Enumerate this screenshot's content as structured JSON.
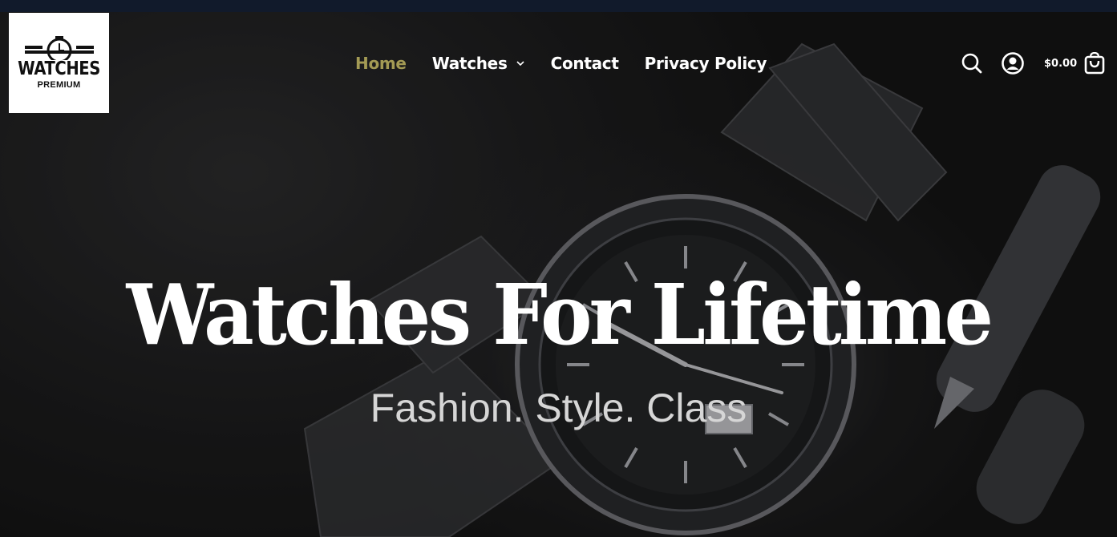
{
  "brand": {
    "logo_word": "WATCHES",
    "logo_sub": "PREMIUM"
  },
  "nav": {
    "items": [
      {
        "label": "Home",
        "active": true
      },
      {
        "label": "Watches",
        "has_dropdown": true
      },
      {
        "label": "Contact"
      },
      {
        "label": "Privacy Policy"
      }
    ]
  },
  "header_tools": {
    "search_icon": "search-icon",
    "account_icon": "user-circle-icon",
    "cart_icon": "shopping-bag-icon",
    "cart_total": "$0.00"
  },
  "hero": {
    "title": "Watches For Lifetime",
    "subtitle": "Fashion. Style. Class"
  },
  "colors": {
    "topbar": "#111a2b",
    "nav_active": "#a39a54",
    "text": "#ffffff"
  }
}
